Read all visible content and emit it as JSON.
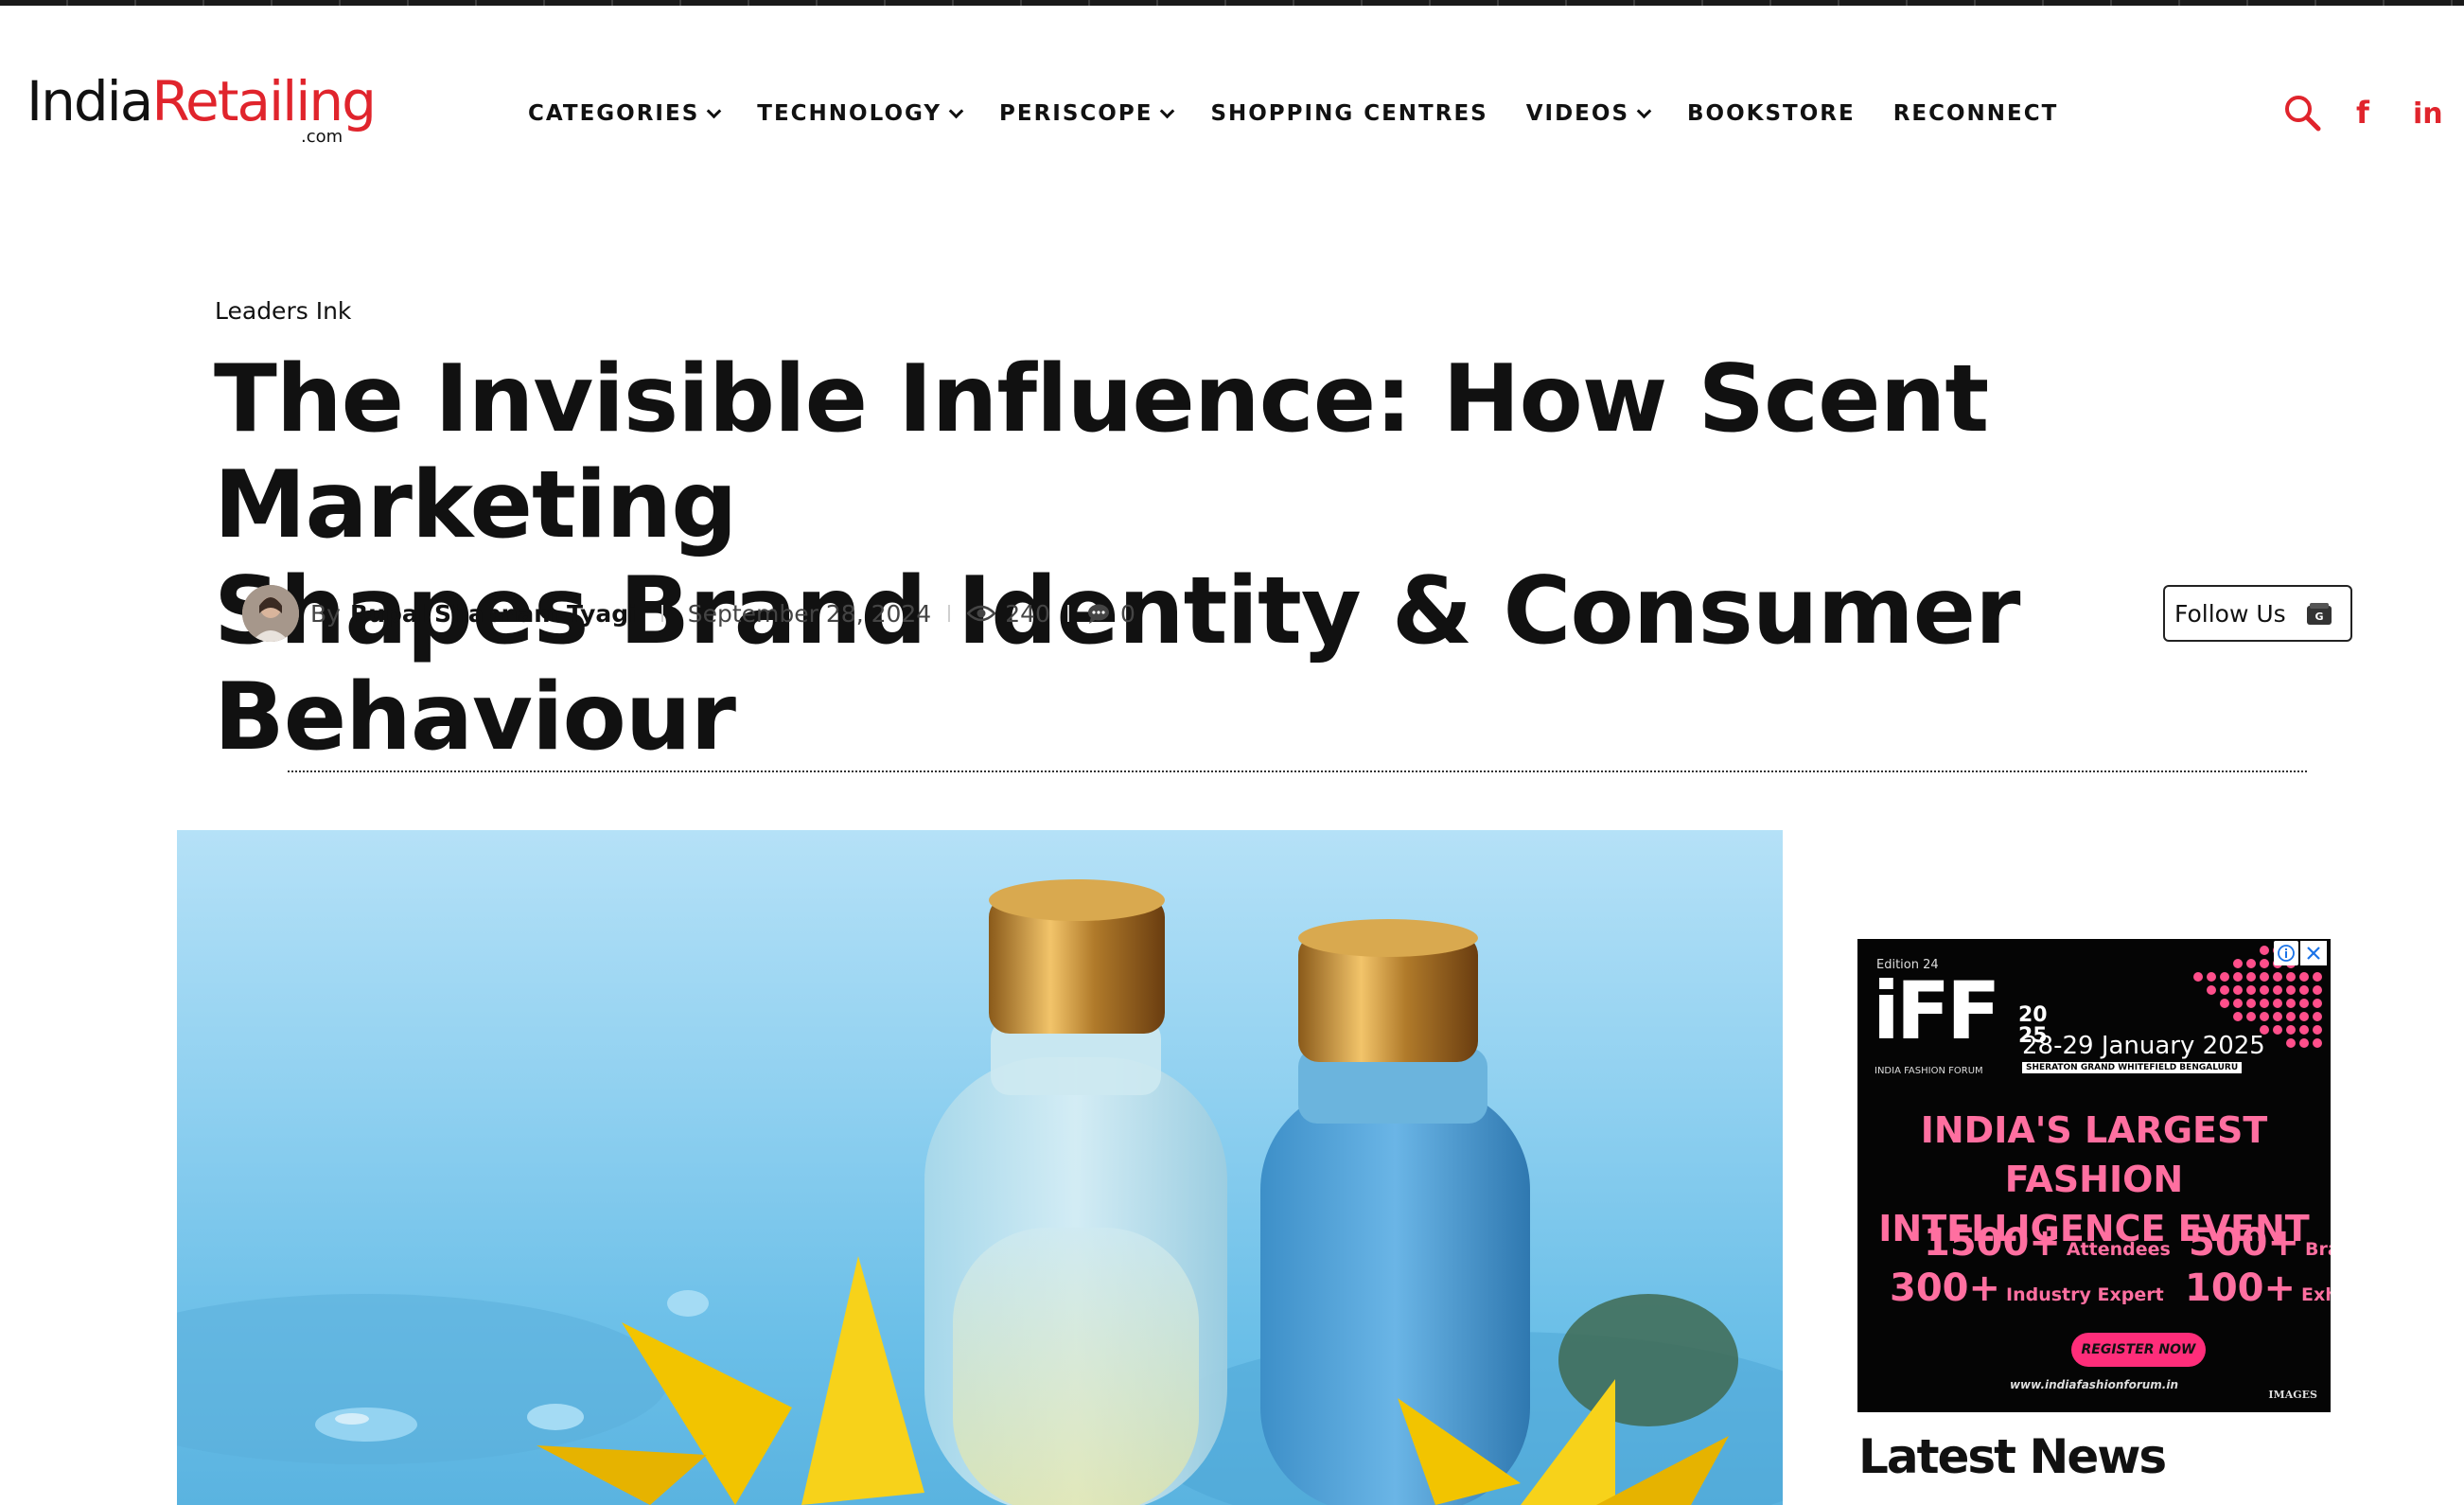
{
  "site": {
    "logo_india": "India",
    "logo_retailing": "Retailing",
    "logo_com": ".com",
    "brand_color": "#e0242c"
  },
  "nav": {
    "items": [
      {
        "label": "CATEGORIES",
        "dropdown": true
      },
      {
        "label": "TECHNOLOGY",
        "dropdown": true
      },
      {
        "label": "PERISCOPE",
        "dropdown": true
      },
      {
        "label": "SHOPPING CENTRES",
        "dropdown": false
      },
      {
        "label": "VIDEOS",
        "dropdown": true
      },
      {
        "label": "BOOKSTORE",
        "dropdown": false
      },
      {
        "label": "RECONNECT",
        "dropdown": false
      }
    ],
    "icons": [
      "search-icon",
      "facebook-icon",
      "linkedin-icon"
    ]
  },
  "article": {
    "category": "Leaders Ink",
    "title_line1": "The Invisible Influence: How Scent Marketing",
    "title_line2": "Shapes Brand Identity & Consumer Behaviour",
    "by": "By",
    "author": "Rupal Shabnam Tyagi",
    "date": "September 28, 2024",
    "views": "240",
    "comments": "0",
    "follow_label": "Follow Us"
  },
  "ad": {
    "edition": "Edition 24",
    "logo": "iFF",
    "year_top": "20",
    "year_bottom": "25",
    "forum": "INDIA FASHION FORUM",
    "date": "28-29 January 2025",
    "venue": "SHERATON GRAND WHITEFIELD BENGALURU",
    "headline_line1": "INDIA'S LARGEST FASHION",
    "headline_line2": "INTELLIGENCE EVENT",
    "stats": [
      {
        "num": "1500+",
        "label": "Attendees"
      },
      {
        "num": "500+",
        "label": "Brands"
      },
      {
        "num": "300+",
        "label": "Industry Expert"
      },
      {
        "num": "100+",
        "label": "Exhibitors"
      }
    ],
    "register": "REGISTER NOW",
    "url": "www.indiafashionforum.in",
    "images_mark": "IMAGES",
    "accent_color": "#ff6fa0"
  },
  "sidebar": {
    "latest_heading": "Latest News"
  }
}
